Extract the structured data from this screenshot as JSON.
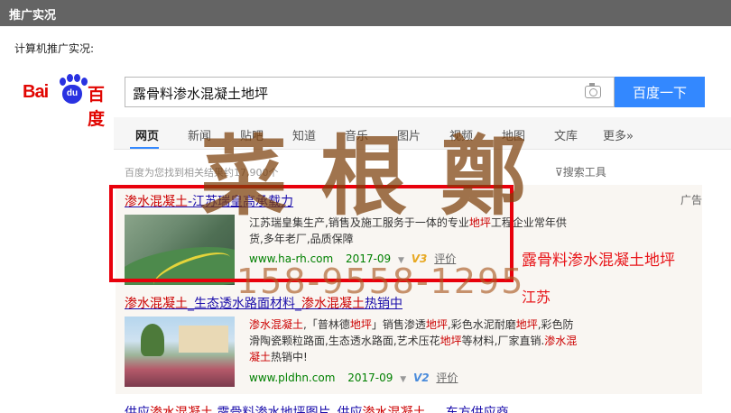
{
  "page_title": "推广实况",
  "caption": "计算机推广实况:",
  "logo": {
    "bai": "Bai",
    "du": "du",
    "baidu_cn": "百度"
  },
  "search": {
    "query": "露骨料渗水混凝土地坪",
    "button": "百度一下"
  },
  "tabs": [
    "网页",
    "新闻",
    "贴吧",
    "知道",
    "音乐",
    "图片",
    "视频",
    "地图",
    "文库",
    "更多»"
  ],
  "result_count": "百度为您找到相关结果约17,900个",
  "search_tools": "搜索工具",
  "ad_label": "广告",
  "results": [
    {
      "title_hl": "渗水混凝土",
      "title_rest": "-江苏瑞皇高承载力",
      "desc_line1_pre": "江苏瑞皇集生产,销售及施工服务于一体的专业",
      "desc_line1_hl": "地坪",
      "desc_line1_post": "工程企业常年供",
      "desc_line2": "货,多年老厂,品质保障",
      "url": "www.ha-rh.com",
      "date": "2017-09",
      "v_badge": "V3",
      "eval": "评价"
    },
    {
      "title_hl1": "渗水混凝土",
      "title_mid": "_生态透水路面材料_",
      "title_hl2": "渗水混凝土",
      "title_rest": "热销中",
      "desc_hl1": "渗水混凝土",
      "desc_p1": ",「普林德",
      "desc_hl2": "地坪",
      "desc_p2": "」销售渗透",
      "desc_hl3": "地坪",
      "desc_p3": ",彩色水泥耐磨",
      "desc_hl4": "地坪",
      "desc_p4": ",彩色防",
      "desc_line2_pre": "滑陶瓷颗粒路面,生态透水路面,艺术压花",
      "desc_line2_hl": "地坪",
      "desc_line2_mid": "等材料,厂家直销.",
      "desc_line2_hl2": "渗水混",
      "desc_line3_hl": "凝土",
      "desc_line3_post": "热销中!",
      "url": "www.pldhn.com",
      "date": "2017-09",
      "v_badge": "V2",
      "eval": "评价"
    }
  ],
  "bottom_title_p1": "供应",
  "bottom_title_hl1": "渗水混凝土",
  "bottom_title_p2": " 露骨料渗水地坪图片_供应",
  "bottom_title_hl2": "渗水混凝土",
  "bottom_title_p3": " ... 东方供应商",
  "watermark": {
    "chars": [
      "菜",
      "根",
      "鄭"
    ],
    "phone": "158-9558-1295"
  },
  "overlay": {
    "keyword": "露骨料渗水混凝土地坪",
    "location": "江苏"
  },
  "colors": {
    "topbar": "#646464",
    "search_button": "#3388ff",
    "red_box": "#e8000b",
    "highlight": "#cc0000"
  }
}
